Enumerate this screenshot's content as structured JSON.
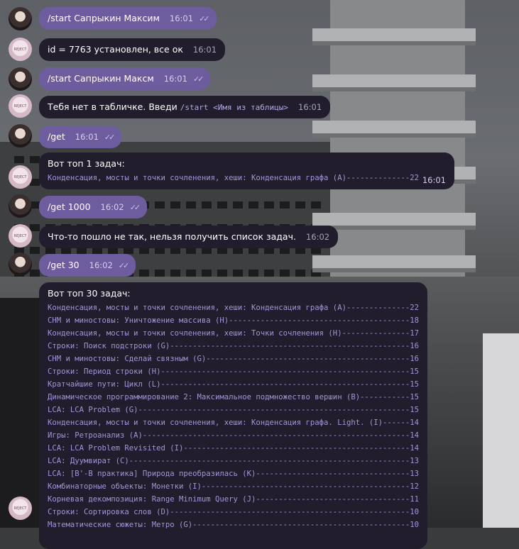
{
  "messages": [
    {
      "text": "/start Сапрыкин Максим",
      "time": "16:01",
      "ticks": "✓✓"
    },
    {
      "text": "id = 7763 установлен, все ок",
      "time": "16:01"
    },
    {
      "text": "/start Сапрыкин Максм",
      "time": "16:01",
      "ticks": "✓✓"
    },
    {
      "text": "Тебя нет в табличке. Введи",
      "cmd": "/start <Имя из таблицы>",
      "time": "16:01"
    },
    {
      "text": "/get",
      "time": "16:01",
      "ticks": "✓✓"
    },
    {
      "head": "Вот топ 1 задач:",
      "lines": [
        "Конденсация, мосты и точки сочленения, хеши: Конденсация графа (A)--------------22"
      ],
      "time": "16:01"
    },
    {
      "text": "/get 1000",
      "time": "16:02",
      "ticks": "✓✓"
    },
    {
      "text": "Что-то пошло не так, нельзя получить список задач.",
      "time": "16:02"
    },
    {
      "text": "/get 30",
      "time": "16:02",
      "ticks": "✓✓"
    },
    {
      "head": "Вот топ 30 задач:",
      "lines": [
        "Конденсация, мосты и точки сочленения, хеши: Конденсация графа (A)--------------22",
        "CHM и миностовы: Уничтожение массива (H)----------------------------------------18",
        "Конденсация, мосты и точки сочленения, хеши: Точки сочленения (H)---------------17",
        "Строки: Поиск подстроки (G)-----------------------------------------------------16",
        "CHM и миностовы: Сделай связным (G)---------------------------------------------16",
        "Строки: Период строки (H)-------------------------------------------------------15",
        "Кратчайшие пути: Цикл (L)-------------------------------------------------------15",
        "Динамическое программирование 2: Максимальное подмножество вершин (B)-----------15",
        "LCA: LCA Problem (G)------------------------------------------------------------15",
        "Конденсация, мосты и точки сочленения, хеши: Конденсация графа. Light. (I)------14",
        "Игры: Ретроанализ (A)-----------------------------------------------------------14",
        "LCA: LCA Problem Revisited (I)--------------------------------------------------14",
        "LCA: Дуумвират (C)--------------------------------------------------------------13",
        "LCA: [B'-B практика] Природа преобразилась (K)----------------------------------13",
        "Комбинаторные объекты: Монетки (I)----------------------------------------------12",
        "Корневая декомпозиция: Range Minimum Query (J)----------------------------------11",
        "Строки: Сортировка слов (D)-----------------------------------------------------10",
        "Математические сюжеты: Метро (G)------------------------------------------------10"
      ]
    }
  ]
}
